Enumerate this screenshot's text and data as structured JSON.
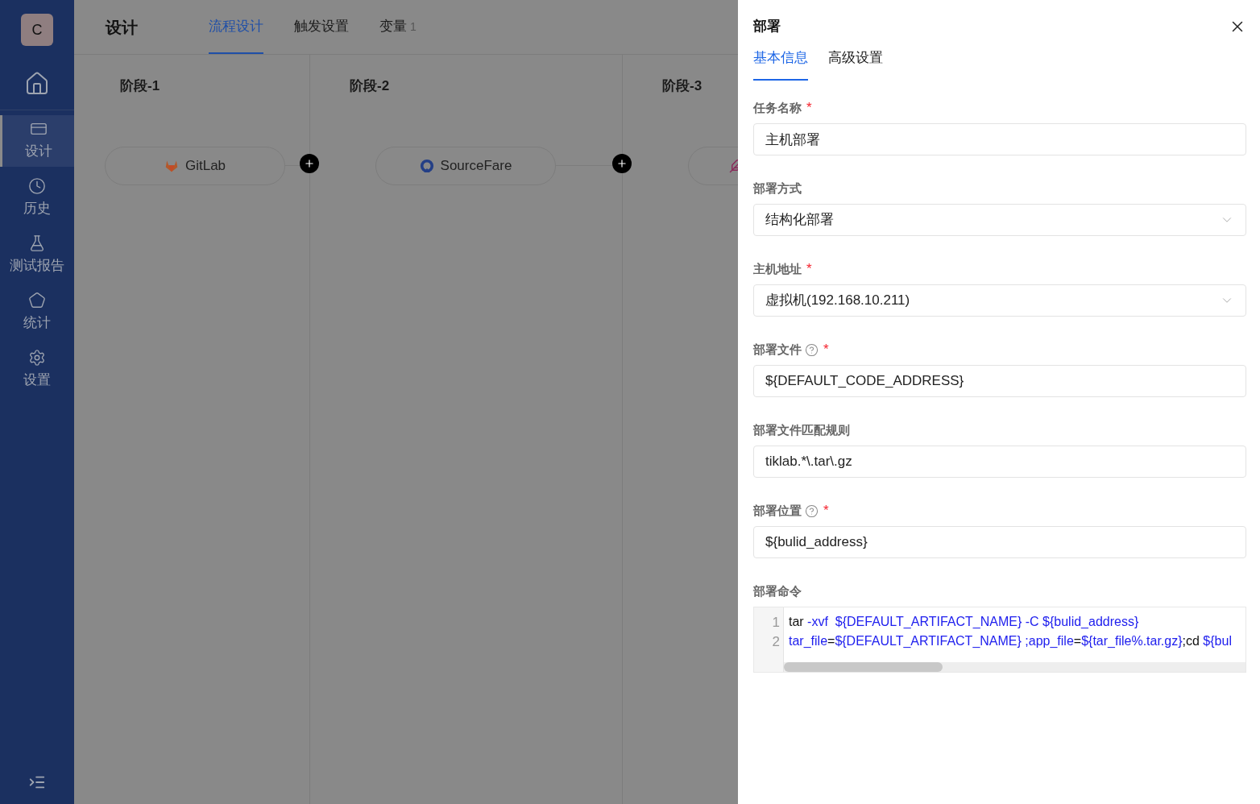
{
  "sidebar": {
    "avatar": "C",
    "items": [
      {
        "kind": "home",
        "selected": false
      },
      {
        "kind": "design",
        "label": "设计",
        "selected": true
      },
      {
        "kind": "history",
        "label": "历史",
        "selected": false
      },
      {
        "kind": "test",
        "label": "测试报告",
        "selected": false
      },
      {
        "kind": "stats",
        "label": "统计",
        "selected": false
      },
      {
        "kind": "settings",
        "label": "设置",
        "selected": false
      }
    ]
  },
  "header": {
    "title": "设计",
    "tabs": [
      {
        "label": "流程设计",
        "selected": true
      },
      {
        "label": "触发设置",
        "selected": false
      },
      {
        "label": "变量",
        "count": "1",
        "selected": false
      }
    ]
  },
  "stages": [
    {
      "title": "阶段-1",
      "node": {
        "kind": "gitlab",
        "label": "GitLab"
      }
    },
    {
      "title": "阶段-2",
      "node": {
        "kind": "sourcefare",
        "label": "SourceFare"
      }
    },
    {
      "title": "阶段-3",
      "node": {
        "kind": "feather"
      }
    }
  ],
  "drawer": {
    "title": "部署",
    "tabs": [
      {
        "label": "基本信息",
        "selected": true
      },
      {
        "label": "高级设置",
        "selected": false
      }
    ],
    "fields": [
      {
        "kind": "input",
        "label": "任务名称",
        "required_mark": "*",
        "help": false,
        "value": "主机部署"
      },
      {
        "kind": "select",
        "label": "部署方式",
        "help": false,
        "value": "结构化部署"
      },
      {
        "kind": "select",
        "label": "主机地址",
        "required_mark": "*",
        "help": false,
        "value": "虚拟机(192.168.10.211)"
      },
      {
        "kind": "input",
        "label": "部署文件",
        "required_mark": "*",
        "help": true,
        "value": "${DEFAULT_CODE_ADDRESS}"
      },
      {
        "kind": "input",
        "label": "部署文件匹配规则",
        "help": false,
        "value": "tiklab.*\\.tar\\.gz"
      },
      {
        "kind": "input",
        "label": "部署位置",
        "required_mark": "*",
        "help": true,
        "value": "${bulid_address}"
      }
    ],
    "command": {
      "label": "部署命令",
      "lines": [
        {
          "number": "1",
          "tokens": [
            {
              "kind": "plain",
              "text": "tar"
            },
            {
              "kind": "var",
              "text": " -xvf  ${DEFAULT_ARTIFACT_NAME} -C ${bulid_address}"
            }
          ]
        },
        {
          "number": "2",
          "tokens": [
            {
              "kind": "var",
              "text": "tar_file"
            },
            {
              "kind": "plain",
              "text": "="
            },
            {
              "kind": "var",
              "text": "${DEFAULT_ARTIFACT_NAME} ;app_file"
            },
            {
              "kind": "plain",
              "text": "="
            },
            {
              "kind": "var",
              "text": "${tar_file%.tar.gz}"
            },
            {
              "kind": "plain",
              "text": ";cd "
            },
            {
              "kind": "var",
              "text": "${bul"
            }
          ]
        }
      ]
    }
  }
}
